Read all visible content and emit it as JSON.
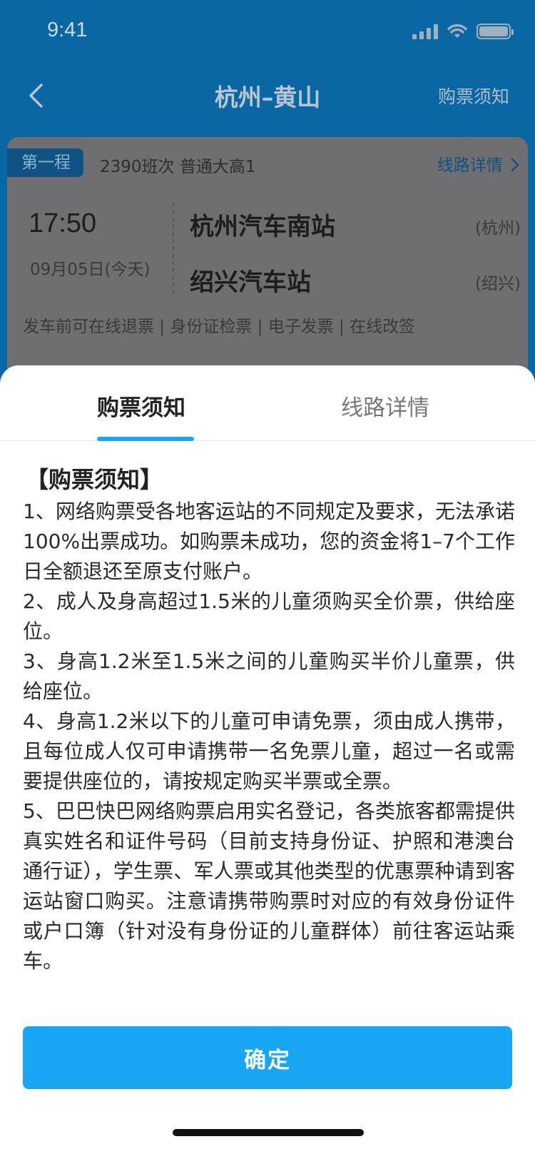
{
  "status_bar": {
    "time": "9:41"
  },
  "nav": {
    "title": "杭州–黄山",
    "right_link": "购票须知"
  },
  "trip": {
    "leg_label": "第一程",
    "bus_info": "2390班次 普通大高1",
    "route_link": "线路详情",
    "depart_time": "17:50",
    "depart_date": "09月05日(今天)",
    "from_station": "杭州汽车南站",
    "from_city": "(杭州)",
    "to_station": "绍兴汽车站",
    "to_city": "(绍兴)",
    "features": "发车前可在线退票 | 身份证检票 | 电子发票 | 在线改签"
  },
  "sheet": {
    "tabs": [
      {
        "label": "购票须知",
        "active": true
      },
      {
        "label": "线路详情",
        "active": false
      }
    ],
    "heading": "【购票须知】",
    "paragraphs": [
      "1、网络购票受各地客运站的不同规定及要求，无法承诺100%出票成功。如购票未成功，您的资金将1–7个工作日全额退还至原支付账户。",
      "2、成人及身高超过1.5米的儿童须购买全价票，供给座位。",
      "3、身高1.2米至1.5米之间的儿童购买半价儿童票，供给座位。",
      "4、身高1.2米以下的儿童可申请免票，须由成人携带，且每位成人仅可申请携带一名免票儿童，超过一名或需要提供座位的，请按规定购买半票或全票。",
      "5、巴巴快巴网络购票启用实名登记，各类旅客都需提供真实姓名和证件号码（目前支持身份证、护照和港澳台通行证），学生票、军人票或其他类型的优惠票种请到客运站窗口购买。注意请携带购票时对应的有效身份证件或户口簿（针对没有身份证的儿童群体）前往客运站乘车。"
    ],
    "confirm_label": "确定"
  },
  "colors": {
    "accent": "#17a7f2",
    "nav_bg": "#0a67a3"
  }
}
